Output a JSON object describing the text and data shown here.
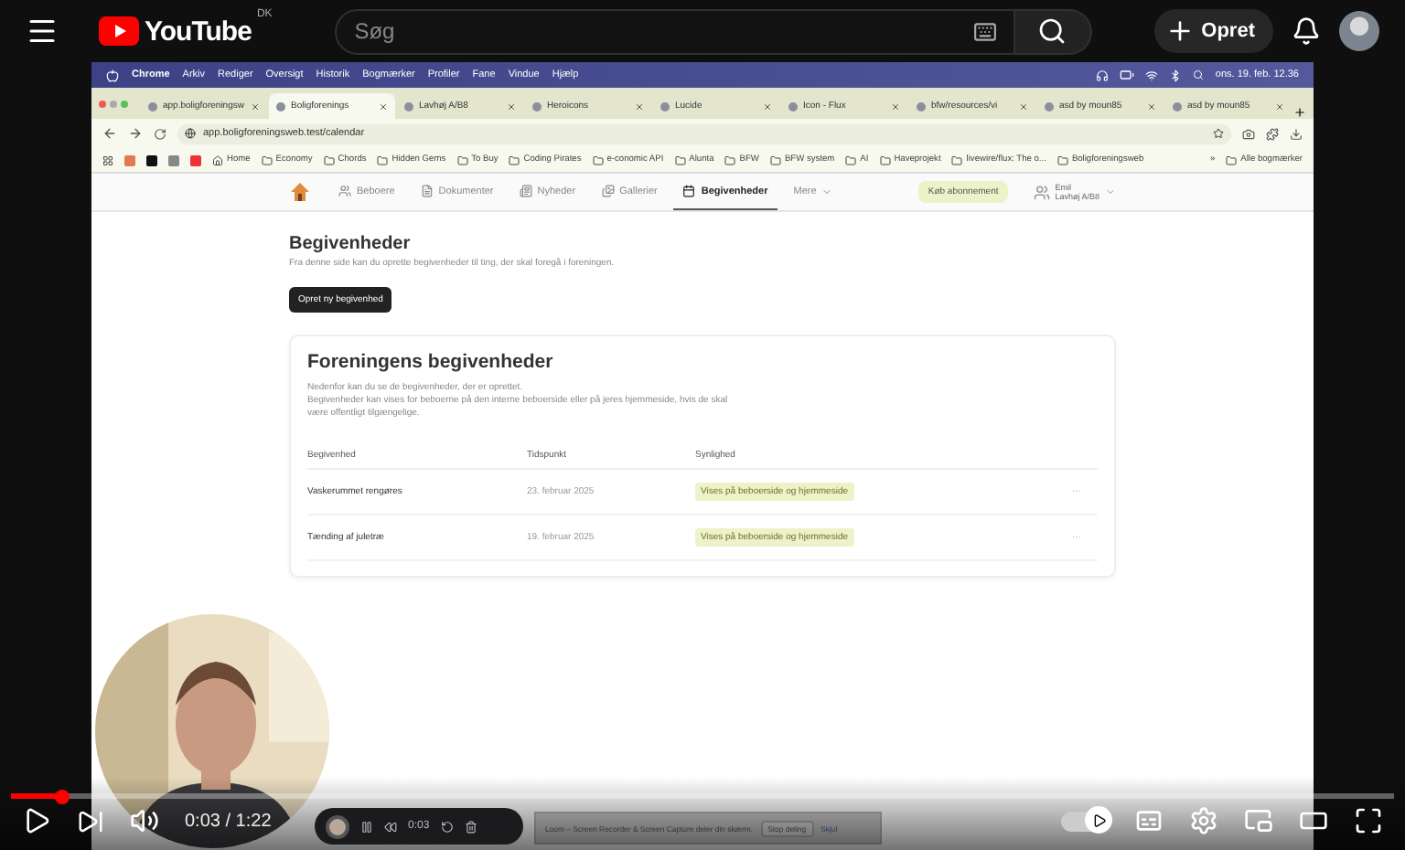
{
  "header": {
    "logo": "YouTube",
    "country": "DK",
    "search": {
      "placeholder": "Søg"
    },
    "create_button": "Opret"
  },
  "recording": {
    "menubar": {
      "items": [
        "Chrome",
        "Arkiv",
        "Rediger",
        "Oversigt",
        "Historik",
        "Bogmærker",
        "Profiler",
        "Fane",
        "Vindue",
        "Hjælp"
      ],
      "clock": "ons. 19. feb. 12.36"
    },
    "tabs": [
      {
        "label": "app.boligforeningsw",
        "selected": false
      },
      {
        "label": "Boligforenings",
        "selected": true
      },
      {
        "label": "Lavhøj A/B8",
        "selected": false
      },
      {
        "label": "Heroicons",
        "selected": false
      },
      {
        "label": "Lucide",
        "selected": false
      },
      {
        "label": "Icon - Flux",
        "selected": false
      },
      {
        "label": "bfw/resources/vi",
        "selected": false
      },
      {
        "label": "asd by moun85",
        "selected": false
      },
      {
        "label": "asd by moun85",
        "selected": false
      }
    ],
    "address": "app.boligforeningsweb.test/calendar",
    "bookmarks": [
      "Home",
      "Economy",
      "Chords",
      "Hidden Gems",
      "To Buy",
      "Coding Pirates",
      "e-conomic API",
      "Alunta",
      "BFW",
      "BFW system",
      "AI",
      "Haveprojekt",
      "livewire/flux: The o...",
      "Boligforeningsweb"
    ],
    "more_bookmarks": "»",
    "all_bookmarks": "Alle bogmærker",
    "app": {
      "nav": [
        {
          "label": "Beboere",
          "selected": false
        },
        {
          "label": "Dokumenter",
          "selected": false
        },
        {
          "label": "Nyheder",
          "selected": false
        },
        {
          "label": "Gallerier",
          "selected": false
        },
        {
          "label": "Begivenheder",
          "selected": true
        },
        {
          "label": "Mere",
          "selected": false
        }
      ],
      "subscribe": "Køb abonnement",
      "user": {
        "name": "Emil",
        "org": "Lavhøj A/B8"
      },
      "page_title": "Begivenheder",
      "page_subtitle": "Fra denne side kan du oprette begivenheder til ting, der skal foregå i foreningen.",
      "create_button": "Opret ny begivenhed",
      "card": {
        "title": "Foreningens begivenheder",
        "description": [
          "Nedenfor kan du se de begivenheder, der er oprettet.",
          "Begivenheder kan vises for beboerne på den interne beboerside eller på jeres hjemmeside, hvis de skal være offentligt tilgængelige."
        ],
        "columns": [
          "Begivenhed",
          "Tidspunkt",
          "Synlighed"
        ],
        "rows": [
          {
            "name": "Vaskerummet rengøres",
            "time": "23. februar 2025",
            "visibility": "Vises på beboerside og hjemmeside",
            "menu": "···"
          },
          {
            "name": "Tænding af juletræ",
            "time": "19. februar 2025",
            "visibility": "Vises på beboerside og hjemmeside",
            "menu": "···"
          }
        ]
      }
    },
    "loom": {
      "timer": "0:03",
      "notice": "Loom – Screen Recorder & Screen Capture deler din skærm.",
      "stop": "Stop deling",
      "hide": "Skjul"
    }
  },
  "player": {
    "time": "0:03 / 1:22",
    "progress": {
      "level": 0.037
    },
    "autoplay": {
      "on": true
    }
  }
}
